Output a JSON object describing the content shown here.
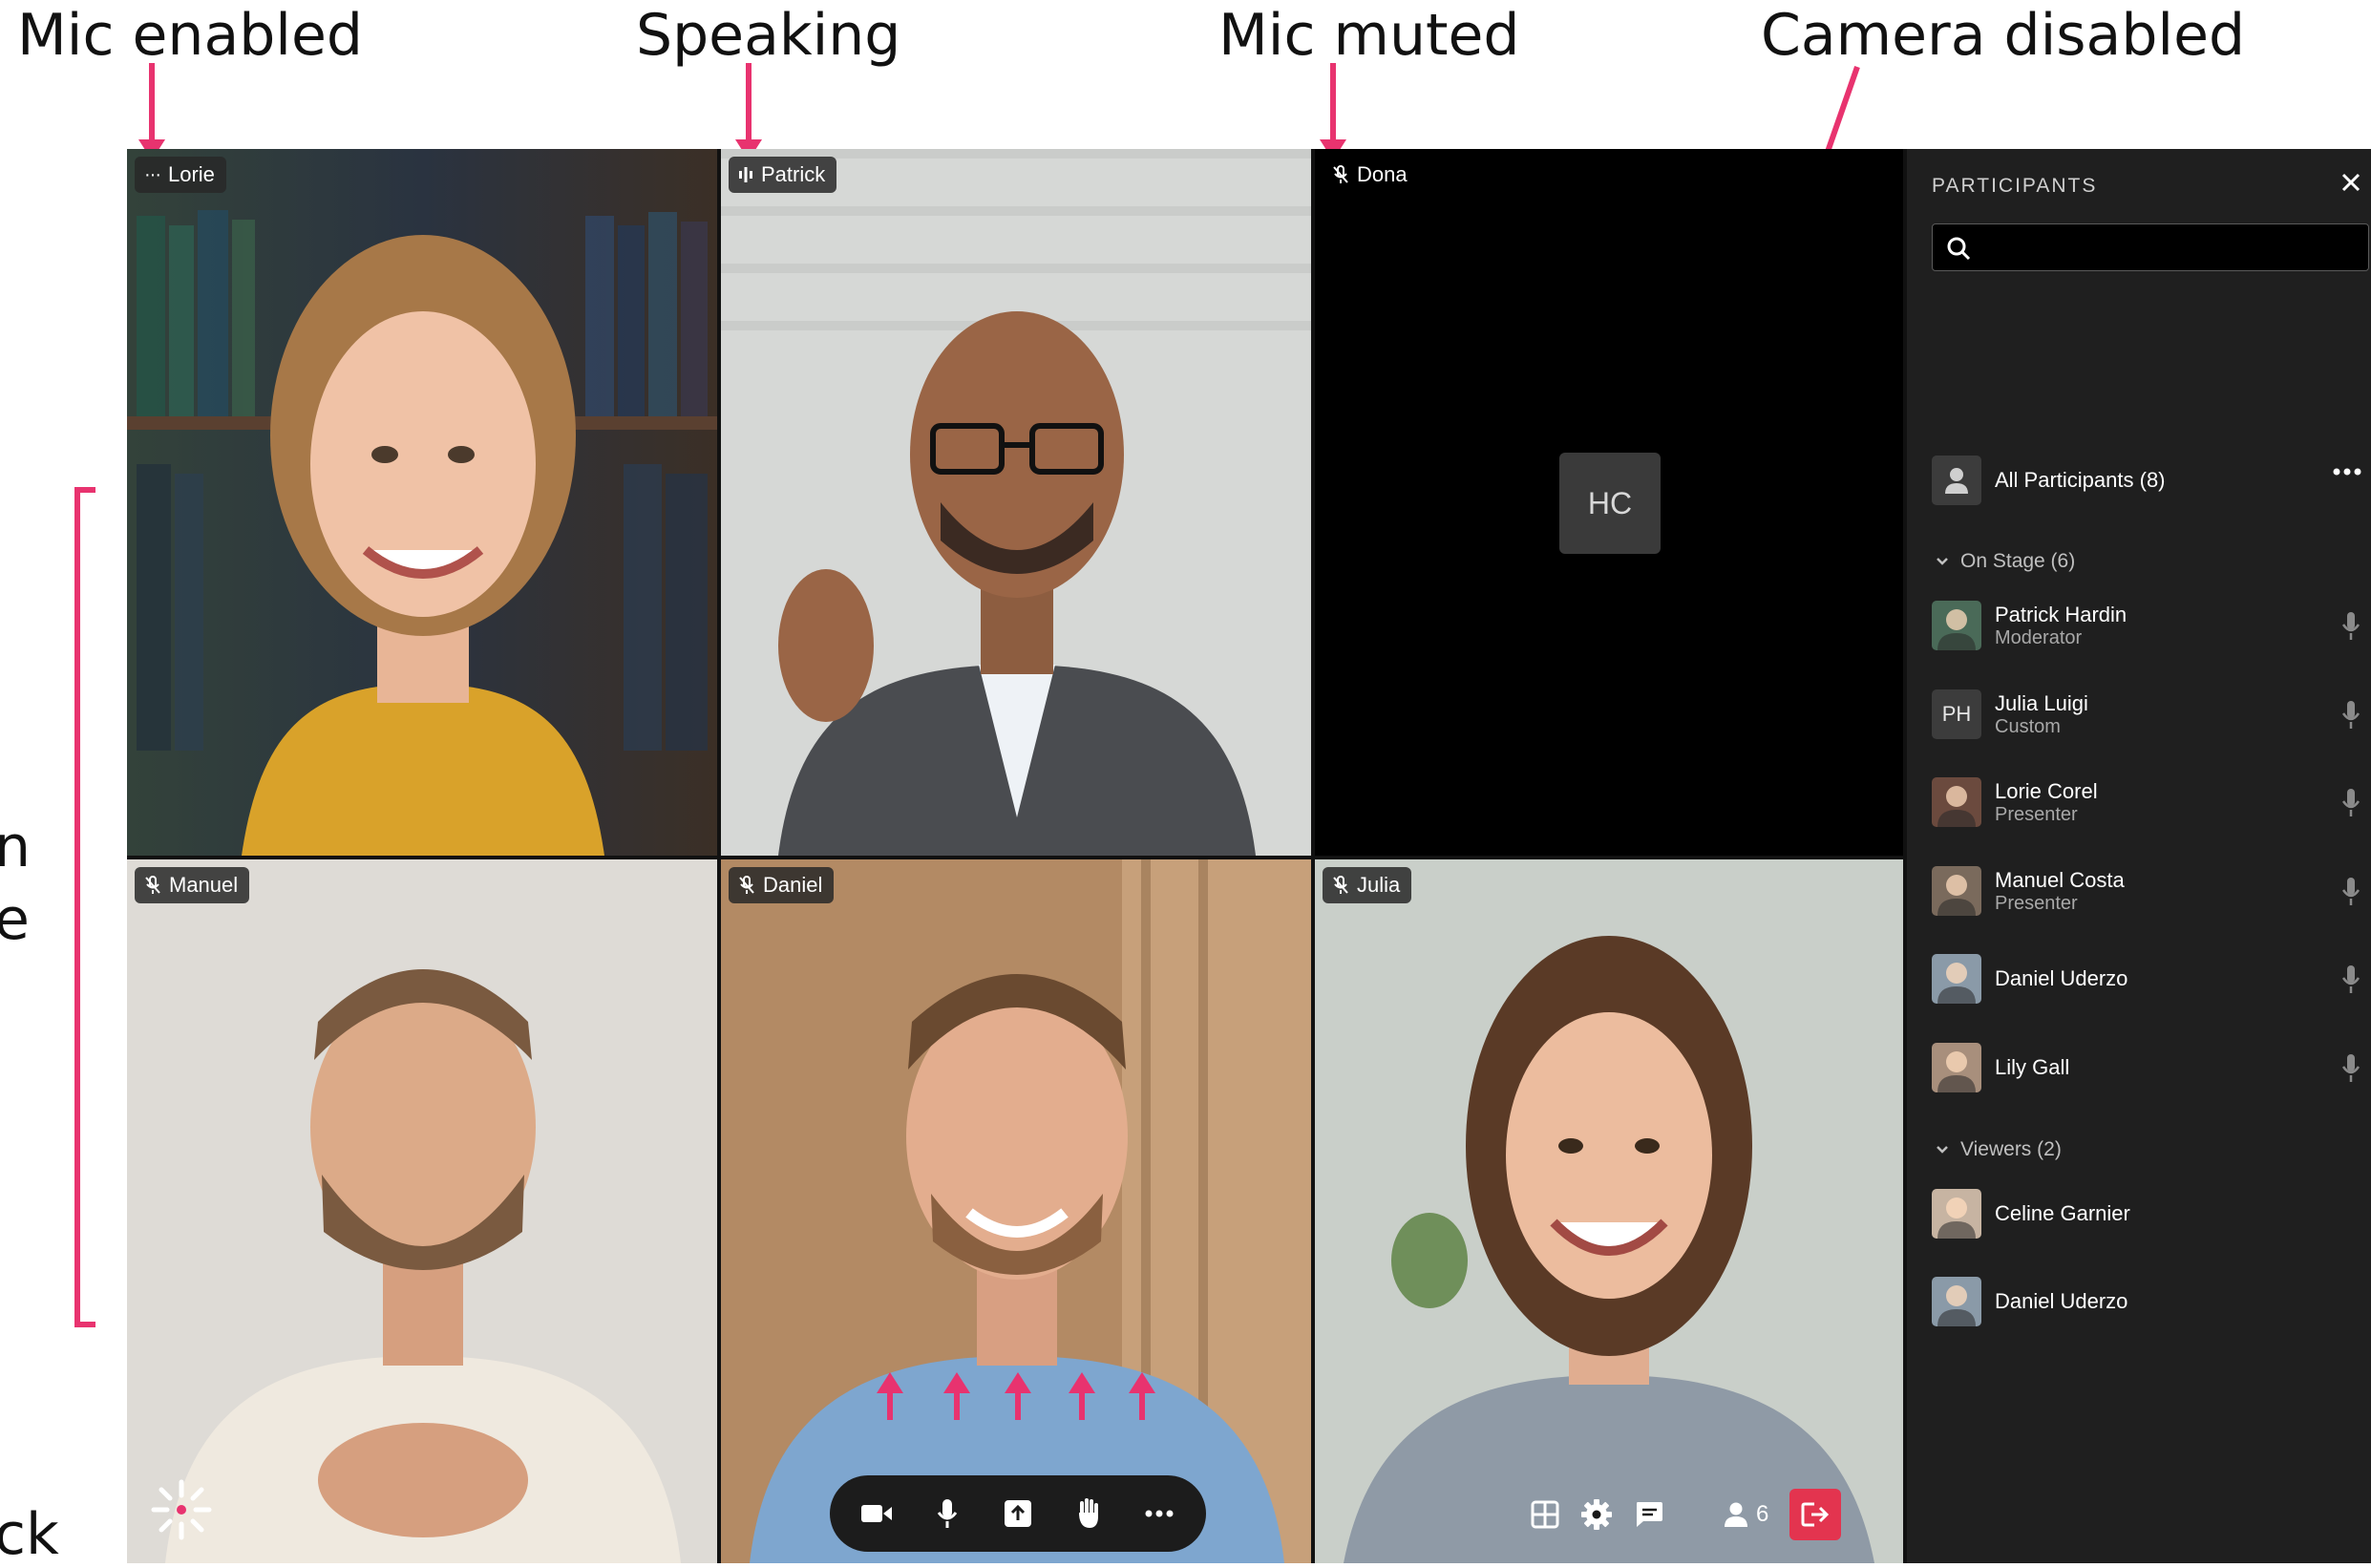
{
  "annotations": {
    "mic_enabled": "Mic enabled",
    "speaking": "Speaking",
    "mic_muted": "Mic muted",
    "camera_disabled": "Camera disabled",
    "edge_n": "n",
    "edge_e": "e",
    "edge_ck": "ck"
  },
  "tiles": [
    {
      "name": "Lorie",
      "status": "mic-enabled"
    },
    {
      "name": "Patrick",
      "status": "speaking"
    },
    {
      "name": "Dona",
      "status": "mic-muted",
      "initials": "HC"
    },
    {
      "name": "Manuel",
      "status": "mic-muted"
    },
    {
      "name": "Daniel",
      "status": "mic-muted"
    },
    {
      "name": "Julia",
      "status": "mic-muted"
    }
  ],
  "toolbar": {
    "icons": [
      "camera-icon",
      "microphone-icon",
      "share-screen-icon",
      "raise-hand-icon",
      "more-icon"
    ]
  },
  "right_tools": {
    "participant_count": "6",
    "icons": [
      "layout-grid-icon",
      "settings-icon",
      "chat-icon",
      "people-icon",
      "leave-icon"
    ]
  },
  "sidebar": {
    "title": "PARTICIPANTS",
    "search_placeholder": "",
    "all_participants": "All Participants (8)",
    "on_stage_label": "On Stage (6)",
    "on_stage": [
      {
        "name": "Patrick Hardin",
        "role": "Moderator",
        "avatar": "photo",
        "color": "#4a6a58"
      },
      {
        "name": "Julia Luigi",
        "role": "Custom",
        "avatar": "PH",
        "color": "#3c3c3c"
      },
      {
        "name": "Lorie Corel",
        "role": "Presenter",
        "avatar": "photo",
        "color": "#6b4a3e"
      },
      {
        "name": "Manuel Costa",
        "role": "Presenter",
        "avatar": "photo",
        "color": "#7a6a5c"
      },
      {
        "name": "Daniel Uderzo",
        "role": "",
        "avatar": "photo",
        "color": "#8a9aa8"
      },
      {
        "name": "Lily Gall",
        "role": "",
        "avatar": "photo",
        "color": "#a88f7c"
      }
    ],
    "viewers_label": "Viewers (2)",
    "viewers": [
      {
        "name": "Celine Garnier",
        "role": "",
        "avatar": "photo",
        "color": "#c7b4a2"
      },
      {
        "name": "Daniel Uderzo",
        "role": "",
        "avatar": "photo",
        "color": "#8a9aa8"
      }
    ]
  },
  "colors": {
    "accent": "#e8336f",
    "leave": "#e3344f",
    "sidebar_bg": "#1f1f1f"
  }
}
